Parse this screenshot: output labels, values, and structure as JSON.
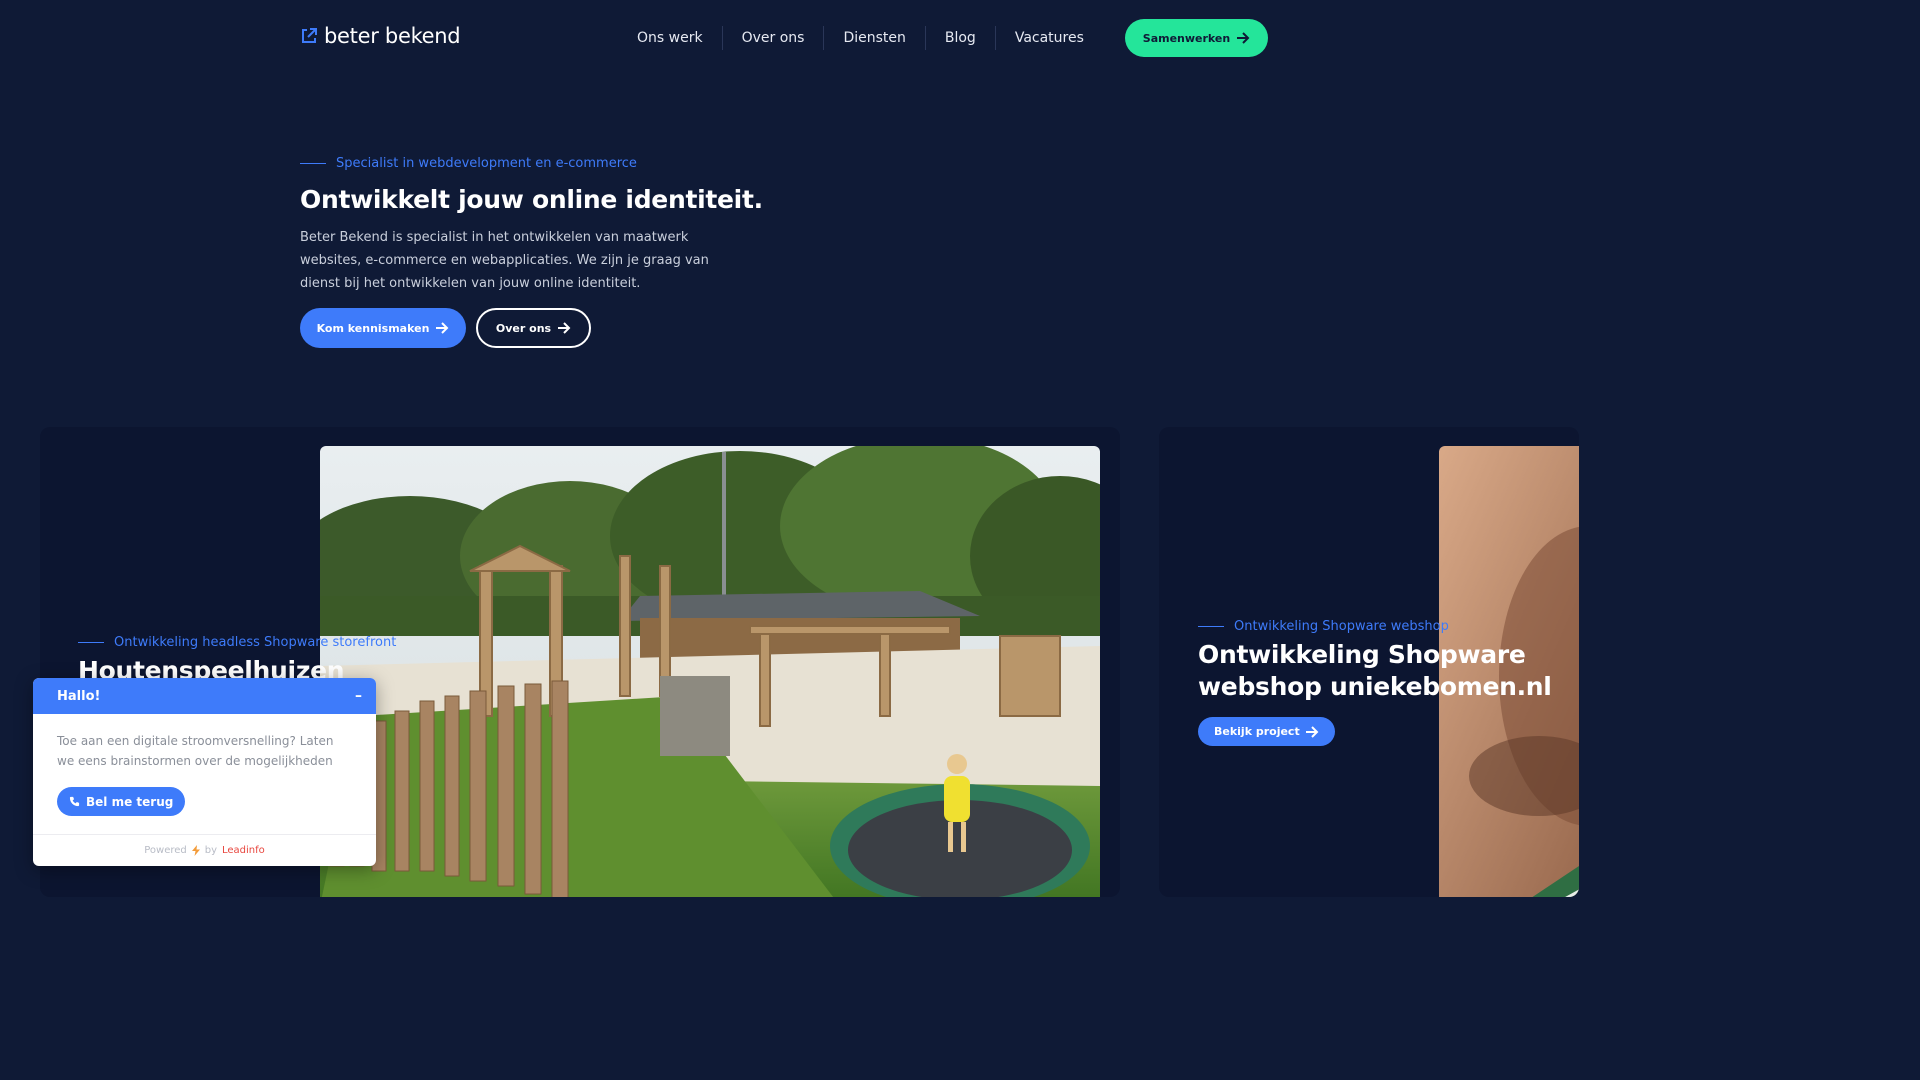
{
  "header": {
    "logo_text": "beter bekend",
    "nav": [
      "Ons werk",
      "Over ons",
      "Diensten",
      "Blog",
      "Vacatures"
    ],
    "cta_label": "Samenwerken"
  },
  "hero": {
    "eyebrow": "Specialist in webdevelopment en e-commerce",
    "title": "Ontwikkelt jouw online identiteit.",
    "text": "Beter Bekend is specialist in het ontwikkelen van maatwerk websites, e-commerce en webapplicaties. We zijn je graag van dienst bij het ontwikkelen van jouw online identiteit.",
    "primary_button": "Kom kennismaken",
    "secondary_button": "Over ons"
  },
  "projects": [
    {
      "eyebrow": "Ontwikkeling headless Shopware storefront",
      "title": "Houtenspeelhuizen"
    },
    {
      "eyebrow": "Ontwikkeling Shopware webshop",
      "title_line1": "Ontwikkeling Shopware",
      "title_line2": "webshop uniekebomen.nl",
      "button": "Bekijk project"
    }
  ],
  "chat": {
    "title": "Hallo!",
    "minimize": "–",
    "message": "Toe aan een digitale stroomversnelling? Laten we eens brainstormen over de mogelijkheden",
    "button": "Bel me terug",
    "footer_powered": "Powered",
    "footer_by": "by",
    "footer_brand": "Leadinfo"
  },
  "colors": {
    "background": "#0f1a36",
    "accent_blue": "#3e7bfa",
    "accent_green": "#24e59a"
  },
  "icons": {
    "logo": "external-link-icon",
    "arrow": "arrow-right-icon",
    "phone": "phone-icon",
    "bolt": "lightning-icon"
  }
}
